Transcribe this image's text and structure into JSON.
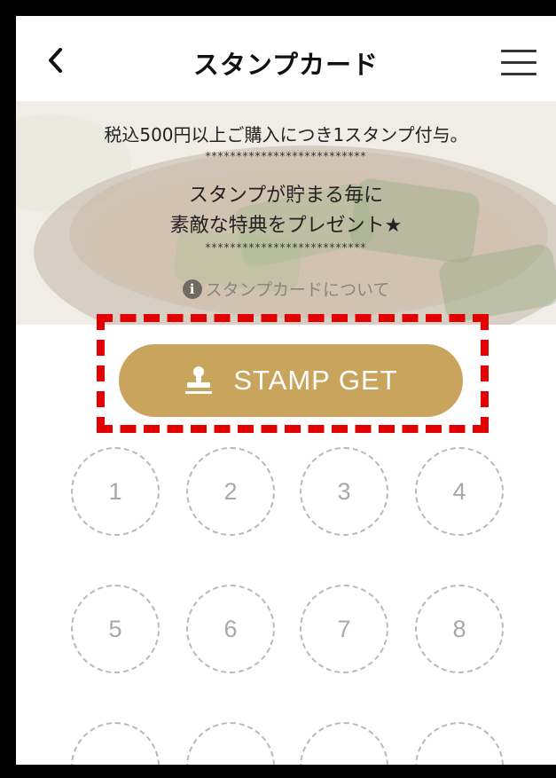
{
  "header": {
    "title": "スタンプカード",
    "back_icon": "chevron-left-icon",
    "menu_icon": "hamburger-menu-icon"
  },
  "hero": {
    "line1": "税込500円以上ご購入につき1スタンプ付与。",
    "stars1": "**************************",
    "line2": "スタンプが貯まる毎に",
    "line3": "素敵な特典をプレゼント★",
    "stars2": "**************************",
    "about_link": "スタンプカードについて",
    "info_icon": "info-icon"
  },
  "stamp_button": {
    "label": "STAMP GET",
    "icon": "stamp-icon",
    "color": "#c9a45c"
  },
  "highlight_color": "#e30000",
  "stamps": [
    "1",
    "2",
    "3",
    "4",
    "5",
    "6",
    "7",
    "8",
    "",
    "",
    "",
    ""
  ]
}
